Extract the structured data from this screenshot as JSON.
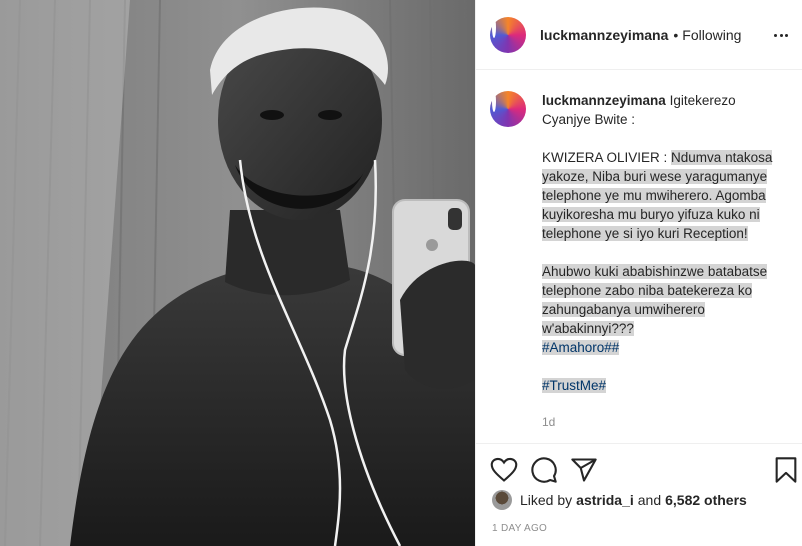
{
  "post": {
    "username": "luckmannzeyimana",
    "separator": "•",
    "follow_status": "Following",
    "photo_alt": "Mirror selfie in black and white"
  },
  "caption": {
    "username": "luckmannzeyimana",
    "title": "Igitekerezo Cyanjye Bwite :",
    "p1_prefix": "KWIZERA OLIVIER :",
    "p1_body": "Ndumva ntakosa yakoze, Niba buri wese yaragumanye telephone ye mu mwiherero. Agomba kuyikoresha mu buryo yifuza kuko ni telephone ye si iyo kuri Reception!",
    "p2_body": "Ahubwo kuki ababishinzwe batabatse telephone zabo niba batekereza ko zahungabanya umwiherero w'abakinnyi???",
    "hashtag1": "#Amahoro##",
    "hashtag2": "#TrustMe#",
    "time_ago": "1d"
  },
  "actions": {
    "icons": [
      "heart-icon",
      "comment-icon",
      "share-icon",
      "bookmark-icon"
    ],
    "liked_by_prefix": "Liked by",
    "liked_by_user": "astrida_i",
    "liked_by_and": "and",
    "others_count": "6,582 others",
    "date": "1 DAY AGO"
  },
  "colors": {
    "text": "#262626",
    "muted": "#8e8e8e",
    "hashtag": "#003569",
    "highlight": "#d4d4d4",
    "border": "#efefef"
  }
}
